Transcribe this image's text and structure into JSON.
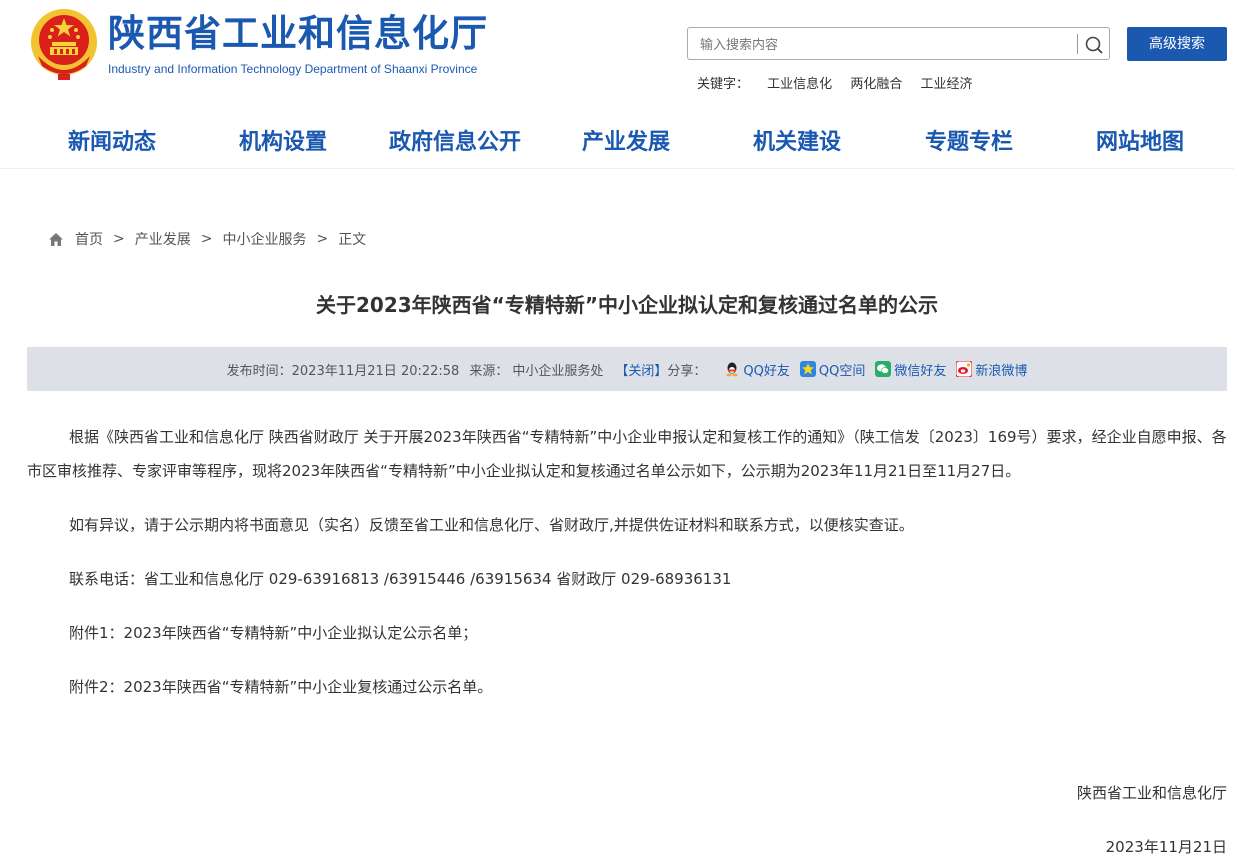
{
  "header": {
    "title": "陕西省工业和信息化厅",
    "subtitle": "Industry and Information Technology Department of Shaanxi Province",
    "search_placeholder": "输入搜索内容",
    "advanced_search": "高级搜索",
    "keywords_label": "关键字：",
    "keywords": [
      "工业信息化",
      "两化融合",
      "工业经济"
    ]
  },
  "nav": [
    "新闻动态",
    "机构设置",
    "政府信息公开",
    "产业发展",
    "机关建设",
    "专题专栏",
    "网站地图"
  ],
  "breadcrumb": [
    "首页",
    "产业发展",
    "中小企业服务",
    "正文"
  ],
  "breadcrumb_sep": ">",
  "article": {
    "title": "关于2023年陕西省“专精特新”中小企业拟认定和复核通过名单的公示",
    "publish_label": "发布时间：",
    "publish_time": "2023年11月21日 20:22:58",
    "source_label": "来源：",
    "source": "中小企业服务处",
    "close": "【关闭】",
    "share_label": "分享：",
    "share": [
      "QQ好友",
      "QQ空间",
      "微信好友",
      "新浪微博"
    ],
    "paragraphs": [
      "根据《陕西省工业和信息化厅 陕西省财政厅 关于开展2023年陕西省“专精特新”中小企业申报认定和复核工作的通知》（陕工信发〔2023〕169号）要求，经企业自愿申报、各市区审核推荐、专家评审等程序，现将2023年陕西省“专精特新”中小企业拟认定和复核通过名单公示如下，公示期为2023年11月21日至11月27日。",
      "如有异议，请于公示期内将书面意见（实名）反馈至省工业和信息化厅、省财政厅,并提供佐证材料和联系方式，以便核实查证。",
      "联系电话：省工业和信息化厅  029-63916813 /63915446 /63915634   省财政厅  029-68936131",
      "附件1：2023年陕西省“专精特新”中小企业拟认定公示名单；",
      "附件2：2023年陕西省“专精特新”中小企业复核通过公示名单。"
    ],
    "signature": "陕西省工业和信息化厅",
    "date": "2023年11月21日"
  },
  "colors": {
    "brand_blue": "#1b59b1",
    "infobar_bg": "#dde1e7"
  }
}
